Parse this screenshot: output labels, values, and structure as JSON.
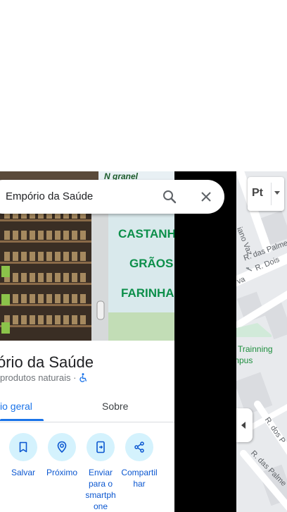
{
  "search": {
    "value": "Empório da Saúde",
    "icons": [
      "search-icon",
      "close-icon"
    ]
  },
  "photo": {
    "sign_top": "N granel",
    "window_lines": [
      "CASTANHAS",
      "GRÃOS",
      "FARINHAS"
    ]
  },
  "place": {
    "title": "ório da Saúde",
    "subtitle": "produtos naturais",
    "separator": "·",
    "accessibility_icon": "wheelchair-icon"
  },
  "tabs": [
    {
      "label": "io geral",
      "active": true
    },
    {
      "label": "Sobre",
      "active": false
    }
  ],
  "actions": [
    {
      "label": "Salvar",
      "icon": "bookmark-icon"
    },
    {
      "label": "Próximo",
      "icon": "nearby-icon"
    },
    {
      "label": "Enviar para o smartphone",
      "icon": "send-to-phone-icon"
    },
    {
      "label": "Compartilhar",
      "icon": "share-icon"
    }
  ],
  "map": {
    "layer_label": "Pt",
    "streets": [
      "iano Vaz",
      "R. Dois",
      "va",
      "R. dos P",
      "R. das Palme"
    ],
    "poi": [
      "Trainning",
      "mpus"
    ]
  },
  "colors": {
    "accent": "#1a73e8",
    "action_bg": "#d4f2fd",
    "poi_green": "#1e8e3e"
  }
}
